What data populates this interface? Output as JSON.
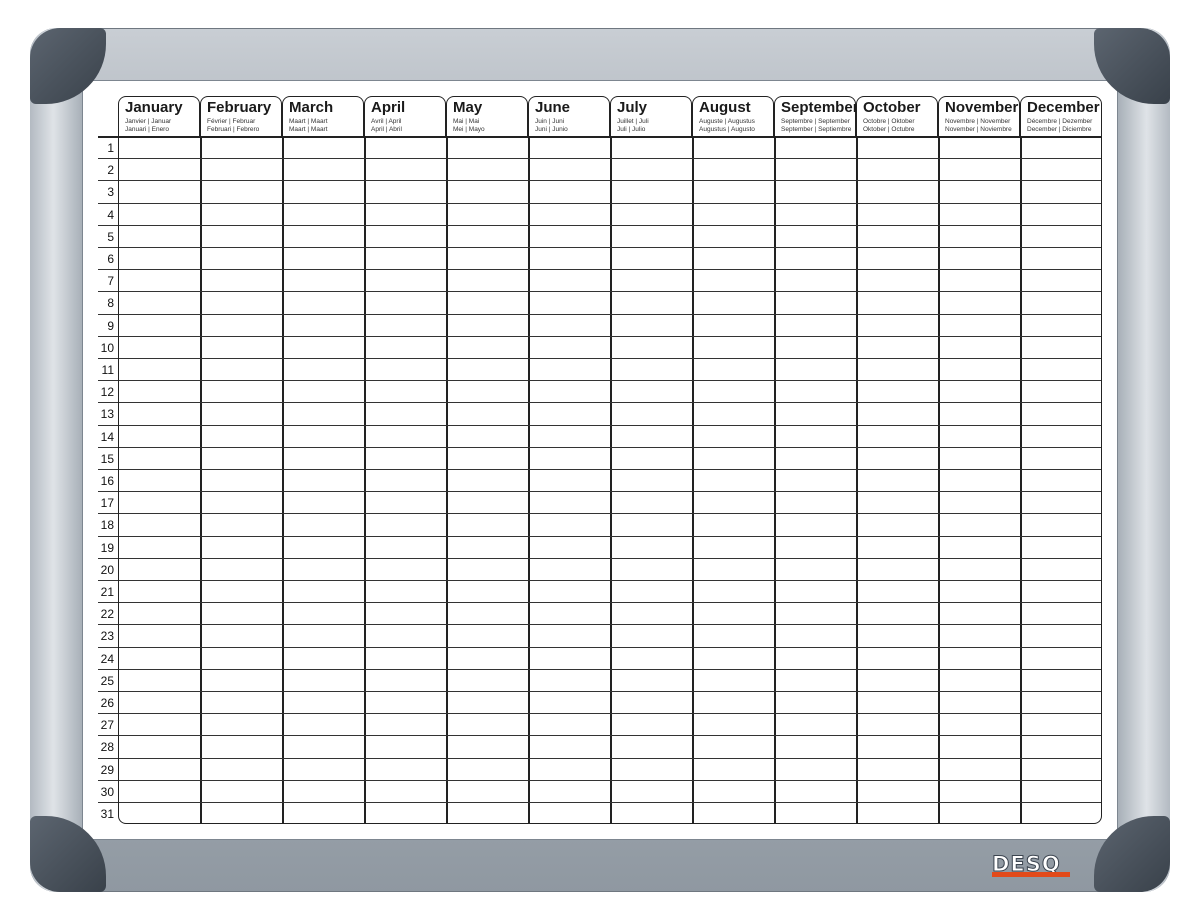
{
  "months": [
    {
      "name": "January",
      "sub1": "Janvier | Januar",
      "sub2": "Januari | Enero"
    },
    {
      "name": "February",
      "sub1": "Février | Februar",
      "sub2": "Februari | Febrero"
    },
    {
      "name": "March",
      "sub1": "Maart | Maart",
      "sub2": "Maart | Maart"
    },
    {
      "name": "April",
      "sub1": "Avril | April",
      "sub2": "April | Abril"
    },
    {
      "name": "May",
      "sub1": "Mai | Mai",
      "sub2": "Mei | Mayo"
    },
    {
      "name": "June",
      "sub1": "Juin | Juni",
      "sub2": "Juni | Junio"
    },
    {
      "name": "July",
      "sub1": "Juillet | Juli",
      "sub2": "Juli | Julio"
    },
    {
      "name": "August",
      "sub1": "Auguste | Augustus",
      "sub2": "Augustus | Augusto"
    },
    {
      "name": "September",
      "sub1": "Septembre | September",
      "sub2": "September | Septiembre"
    },
    {
      "name": "October",
      "sub1": "Octobre | Oktober",
      "sub2": "Oktober | Octubre"
    },
    {
      "name": "November",
      "sub1": "Novembre | November",
      "sub2": "November | Noviembre"
    },
    {
      "name": "December",
      "sub1": "Décembre | Dezember",
      "sub2": "December | Diciembre"
    }
  ],
  "days": [
    "1",
    "2",
    "3",
    "4",
    "5",
    "6",
    "7",
    "8",
    "9",
    "10",
    "11",
    "12",
    "13",
    "14",
    "15",
    "16",
    "17",
    "18",
    "19",
    "20",
    "21",
    "22",
    "23",
    "24",
    "25",
    "26",
    "27",
    "28",
    "29",
    "30",
    "31"
  ],
  "brand": {
    "logo_text": "DESQ",
    "accent": "#e24a1a"
  }
}
